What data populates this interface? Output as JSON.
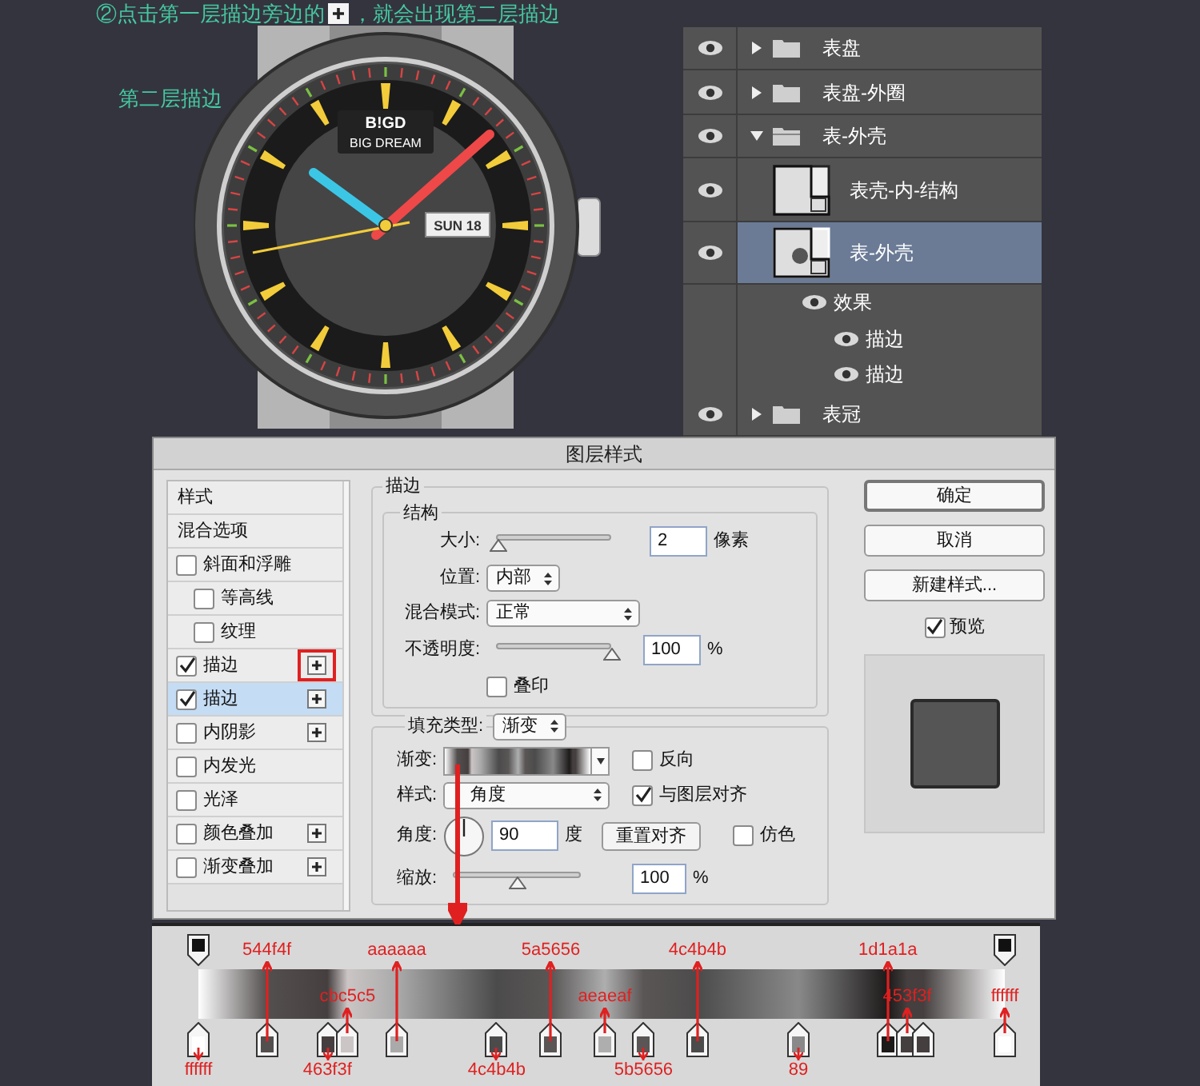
{
  "caption": {
    "before": "②点击第一层描边旁边的",
    "after": "，就会出现第二层描边"
  },
  "watch": {
    "callout": "第二层描边",
    "brand": "B!GD",
    "brand_sub": "BIG DREAM",
    "date_window": "SUN 18"
  },
  "layers": [
    {
      "kind": "group",
      "name": "表盘",
      "expanded": false
    },
    {
      "kind": "group",
      "name": "表盘-外圈",
      "expanded": false
    },
    {
      "kind": "group",
      "name": "表-外壳",
      "expanded": true,
      "children": [
        {
          "kind": "layer",
          "name": "表壳-内-结构",
          "selected": false
        },
        {
          "kind": "layer",
          "name": "表-外壳",
          "selected": true,
          "children": [
            {
              "kind": "effect",
              "name": "效果",
              "children": [
                {
                  "kind": "effect",
                  "name": "描边"
                },
                {
                  "kind": "effect",
                  "name": "描边"
                }
              ]
            }
          ]
        }
      ]
    },
    {
      "kind": "group",
      "name": "表冠",
      "expanded": false
    }
  ],
  "dialog": {
    "title": "图层样式",
    "styles": [
      {
        "kind": "header",
        "label": "样式",
        "selected": false
      },
      {
        "kind": "header",
        "label": "混合选项",
        "selected": false
      },
      {
        "kind": "check",
        "label": "斜面和浮雕",
        "checked": false,
        "selected": false,
        "plus": false,
        "highlighted": false
      },
      {
        "kind": "subcheck",
        "label": "等高线",
        "checked": false,
        "selected": false,
        "plus": false,
        "highlighted": false
      },
      {
        "kind": "subcheck",
        "label": "纹理",
        "checked": false,
        "selected": false,
        "plus": false,
        "highlighted": false
      },
      {
        "kind": "check",
        "label": "描边",
        "checked": true,
        "selected": false,
        "plus": true,
        "highlighted": true
      },
      {
        "kind": "check",
        "label": "描边",
        "checked": true,
        "selected": true,
        "plus": true,
        "highlighted": false
      },
      {
        "kind": "check",
        "label": "内阴影",
        "checked": false,
        "selected": false,
        "plus": true,
        "highlighted": false
      },
      {
        "kind": "check",
        "label": "内发光",
        "checked": false,
        "selected": false,
        "plus": false,
        "highlighted": false
      },
      {
        "kind": "check",
        "label": "光泽",
        "checked": false,
        "selected": false,
        "plus": false,
        "highlighted": false
      },
      {
        "kind": "check",
        "label": "颜色叠加",
        "checked": false,
        "selected": false,
        "plus": true,
        "highlighted": false
      },
      {
        "kind": "check",
        "label": "渐变叠加",
        "checked": false,
        "selected": false,
        "plus": true,
        "highlighted": false
      }
    ],
    "stroke": {
      "legend": "描边",
      "structure": {
        "legend": "结构",
        "size": {
          "label": "大小:",
          "level": 0.02,
          "value": "2",
          "unit": "像素"
        },
        "position": {
          "label": "位置:",
          "value": "内部"
        },
        "blend_mode": {
          "label": "混合模式:",
          "value": "正常"
        },
        "opacity": {
          "label": "不透明度:",
          "level": 1,
          "value": "100",
          "unit": "%"
        },
        "overprint": {
          "label": "叠印",
          "checked": false
        }
      },
      "fill": {
        "label": "填充类型:",
        "value": "渐变",
        "gradient": {
          "label": "渐变:"
        },
        "reverse": {
          "label": "反向",
          "checked": false
        },
        "style": {
          "label": "样式:",
          "value": "角度"
        },
        "align": {
          "label": "与图层对齐",
          "checked": true
        },
        "angle": {
          "label": "角度:",
          "value": "90",
          "unit": "度"
        },
        "reset_button": "重置对齐",
        "dither": {
          "label": "仿色",
          "checked": false
        },
        "scale": {
          "label": "缩放:",
          "level": 0.5,
          "value": "100",
          "unit": "%"
        }
      }
    },
    "buttons": [
      {
        "label": "确定",
        "default": true
      },
      {
        "label": "取消",
        "default": false
      },
      {
        "label": "新建样式...",
        "default": false
      }
    ],
    "preview": {
      "label": "预览",
      "checked": true
    }
  },
  "gradient_editor": {
    "stops": [
      {
        "level": 0,
        "color": "#ffffff",
        "label": "ffffff",
        "kind": "bottom"
      },
      {
        "level": 0.085,
        "color": "#544f4f",
        "label": "544f4f",
        "kind": "top"
      },
      {
        "level": 0.16,
        "color": "#463f3f",
        "label": "463f3f",
        "kind": "bottom"
      },
      {
        "level": 0.185,
        "color": "#cbc5c5",
        "label": "cbc5c5",
        "kind": "middle"
      },
      {
        "level": 0.246,
        "color": "#aaaaaa",
        "label": "aaaaaa",
        "kind": "top"
      },
      {
        "level": 0.37,
        "color": "#4c4b4b",
        "label": "4c4b4b",
        "kind": "bottom"
      },
      {
        "level": 0.437,
        "color": "#5a5656",
        "label": "5a5656",
        "kind": "top"
      },
      {
        "level": 0.504,
        "color": "#aeaeaf",
        "label": "aeaeaf",
        "kind": "middle"
      },
      {
        "level": 0.552,
        "color": "#5b5656",
        "label": "5b5656",
        "kind": "bottom"
      },
      {
        "level": 0.619,
        "color": "#4c4b4b",
        "label": "4c4b4b",
        "kind": "top"
      },
      {
        "level": 0.744,
        "color": "#898989",
        "label": "89",
        "kind": "bottom"
      },
      {
        "level": 0.855,
        "color": "#1d1a1a",
        "label": "1d1a1a",
        "kind": "top"
      },
      {
        "level": 0.879,
        "color": "#453f3f",
        "label": "453f3f",
        "kind": "middle"
      },
      {
        "level": 0.899,
        "color": "#453f3f",
        "kind": "plain"
      },
      {
        "level": 1,
        "color": "#ffffff",
        "label": "ffffff",
        "kind": "middle"
      }
    ]
  }
}
